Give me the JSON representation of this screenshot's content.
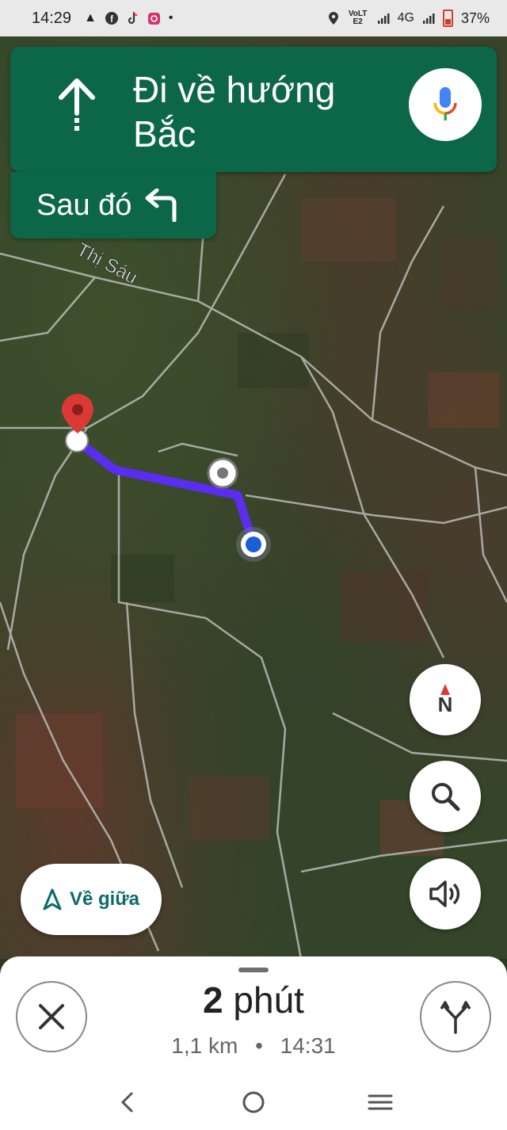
{
  "status_bar": {
    "time": "14:29",
    "network_label": "VoLTE2",
    "network_type": "4G",
    "battery": "37%"
  },
  "navigation": {
    "instruction": "Đi về hướng Bắc",
    "then_label": "Sau đó",
    "street_label": "Thị Sáu"
  },
  "controls": {
    "compass_label": "N",
    "recenter_label": "Về giữa"
  },
  "trip": {
    "duration_value": "2",
    "duration_unit": "phút",
    "distance": "1,1 km",
    "separator": "•",
    "arrival_time": "14:31"
  },
  "colors": {
    "banner": "#0c6748",
    "route": "#5b2df0",
    "destination_pin": "#db3a34",
    "location_dot": "#1a5fd6"
  }
}
